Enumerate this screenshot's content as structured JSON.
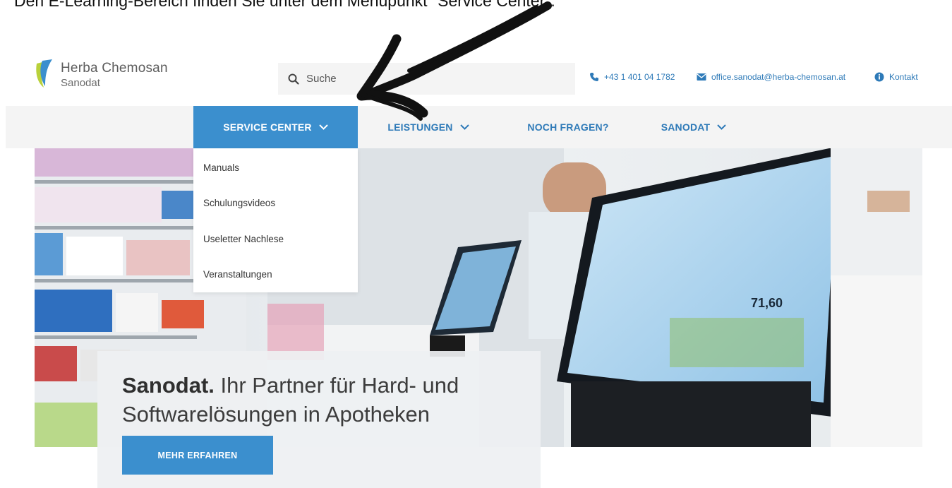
{
  "caption": "Den E-Learning-Bereich finden Sie unter dem Menüpunkt \"Service Center\".",
  "brand": {
    "name": "Herba Chemosan",
    "sub": "Sanodat"
  },
  "search": {
    "placeholder": "Suche"
  },
  "contact": {
    "phone": "+43 1 401 04 1782",
    "email": "office.sanodat@herba-chemosan.at",
    "kontakt": "Kontakt"
  },
  "nav": {
    "items": [
      {
        "label": "SERVICE CENTER",
        "dropdown": true,
        "active": true
      },
      {
        "label": "LEISTUNGEN",
        "dropdown": true
      },
      {
        "label": "NOCH FRAGEN?",
        "dropdown": false
      },
      {
        "label": "SANODAT",
        "dropdown": true
      }
    ]
  },
  "dropdown": {
    "items": [
      "Manuals",
      "Schulungsvideos",
      "Useletter Nachlese",
      "Veranstaltungen"
    ]
  },
  "hero": {
    "headline_bold": "Sanodat.",
    "headline_rest_1": " Ihr Partner für Hard- und",
    "headline_line_2": "Softwarelösungen in Apotheken",
    "cta": "MEHR ERFAHREN",
    "screen_amount": "71,60"
  },
  "colors": {
    "accent": "#3b8fce",
    "link": "#2e7ab8",
    "nav_bg": "#f4f4f4"
  }
}
